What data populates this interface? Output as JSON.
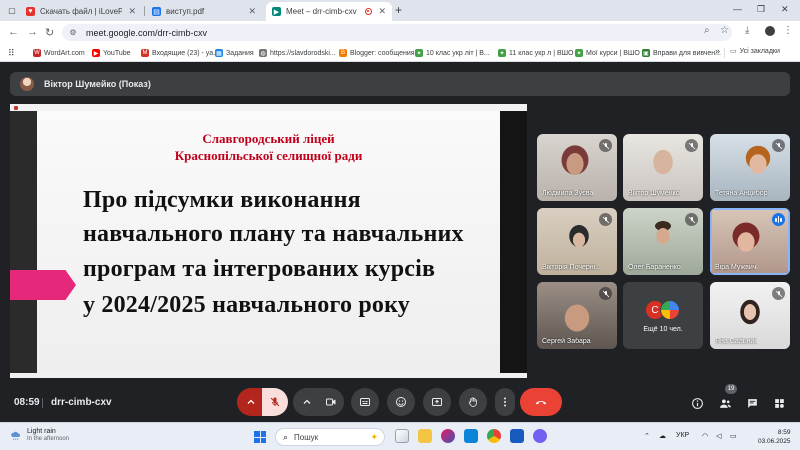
{
  "browser": {
    "tabs": [
      {
        "title": "Скачать файл | iLovePDF",
        "active": false
      },
      {
        "title": "виступ.pdf",
        "active": false
      },
      {
        "title": "Meet – drr-cimb-cxv",
        "active": true
      }
    ],
    "url": "meet.google.com/drr-cimb-cxv",
    "bookmarks": [
      {
        "label": "WordArt.com",
        "color": "#c62828"
      },
      {
        "label": "YouTube",
        "color": "#ff0000"
      },
      {
        "label": "Входящие (23) - ya...",
        "color": "#d93025"
      },
      {
        "label": "Задания",
        "color": "#1e88e5"
      },
      {
        "label": "https://slavdorodski...",
        "color": "#757575"
      },
      {
        "label": "Blogger: сообщения",
        "color": "#f57c00"
      },
      {
        "label": "10 клас укр літ | В...",
        "color": "#43a047"
      },
      {
        "label": "11 клас укр л | ВШО",
        "color": "#43a047"
      },
      {
        "label": "Мої курси | ВШО",
        "color": "#43a047"
      },
      {
        "label": "Вправи для вивчен...",
        "color": "#2e7d32"
      }
    ],
    "bookmarks_all": "Усі закладки"
  },
  "meet": {
    "presenter": "Віктор Шумейко (Показ)",
    "slide": {
      "school_line1": "Славгородський ліцей",
      "school_line2": "Краснопільської селищної ради",
      "title_lines": [
        "Про підсумки виконання",
        "навчального плану та навчальних",
        "програм та інтегрованих курсів",
        "у 2024/2025 навчального року"
      ]
    },
    "participants": [
      {
        "name": "Людмила Зуєва",
        "muted": true
      },
      {
        "name": "Віктор Шумейко",
        "muted": true
      },
      {
        "name": "Тетяна Анцибор",
        "muted": true
      },
      {
        "name": "Вікторія Почерні...",
        "muted": true
      },
      {
        "name": "Олег Бараненко",
        "muted": true
      },
      {
        "name": "Віра Мужвич",
        "muted": false,
        "speaking": true
      },
      {
        "name": "Сергей Забара",
        "muted": true
      },
      {
        "name": "Яна Сальник",
        "muted": true
      }
    ],
    "more": {
      "avatar_letter": "С",
      "label": "Ещё 10 чел."
    },
    "time": "08:59",
    "code": "drr-cimb-cxv",
    "people_count": "19",
    "colors": {
      "end_call": "#ea4335",
      "muted_mic_bg": "#f9dedc",
      "speaking": "#1a73e8"
    }
  },
  "taskbar": {
    "weather_title": "Light rain",
    "weather_sub": "In the afternoon",
    "search_label": "Пошук",
    "language": "УКР",
    "clock_time": "8:59",
    "clock_date": "03.06.2025"
  }
}
